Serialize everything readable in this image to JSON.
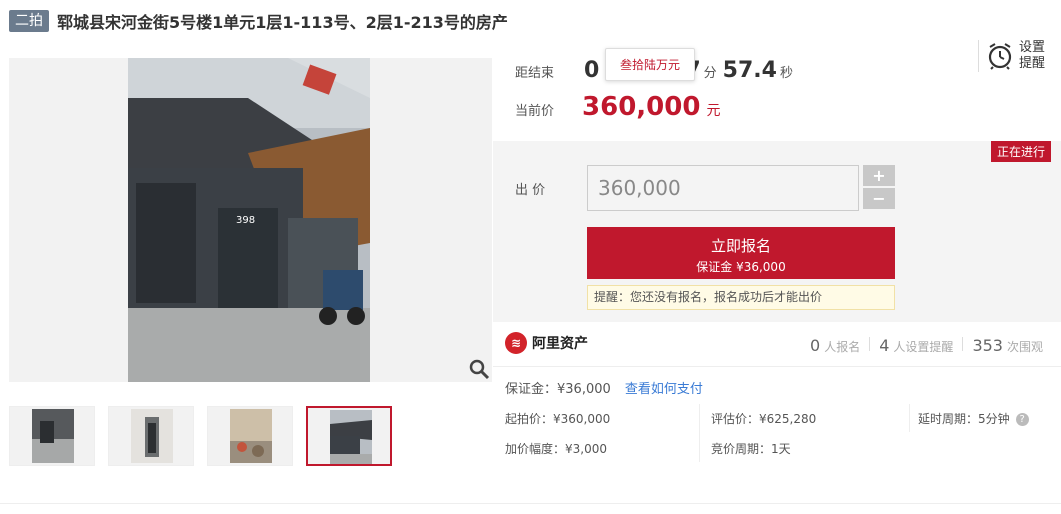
{
  "header": {
    "round_badge": "二拍",
    "title": "郓城县宋河金街5号楼1单元1层1-113号、2层1-213号的房产"
  },
  "gallery": {
    "photo_label": "398",
    "zoom_icon": "magnifier-icon",
    "thumbnails": [
      {
        "name": "thumbnail-1"
      },
      {
        "name": "thumbnail-2"
      },
      {
        "name": "thumbnail-3"
      },
      {
        "name": "thumbnail-4",
        "active": true
      }
    ]
  },
  "countdown": {
    "label": "距结束",
    "hours_partial": "0",
    "minutes_partial": "7",
    "minutes_unit": "分",
    "seconds": "57.4",
    "seconds_unit": "秒",
    "tooltip": "叁拾陆万元"
  },
  "current_price": {
    "label": "当前价",
    "value": "360,000",
    "unit": "元"
  },
  "reminder": {
    "icon": "alarm-clock-icon",
    "label": "设置提醒"
  },
  "bid": {
    "status_tag": "正在进行",
    "label": "出 价",
    "input_value": "360,000",
    "plus": "+",
    "minus": "−",
    "signup_main": "立即报名",
    "signup_sub": "保证金 ¥36,000",
    "notice": "提醒：您还没有报名，报名成功后才能出价"
  },
  "info": {
    "brand": "阿里资产",
    "signups_count": "0",
    "signups_label": "人报名",
    "reminders_count": "4",
    "reminders_label": "人设置提醒",
    "views_count": "353",
    "views_label": "次围观",
    "deposit": "保证金：¥36,000",
    "deposit_link": "查看如何支付",
    "start_price": "起拍价：¥360,000",
    "appraisal": "评估价：¥625,280",
    "delay_period": "延时周期：5分钟",
    "increment": "加价幅度：¥3,000",
    "auction_period": "竞价周期：1天"
  },
  "colors": {
    "accent_red": "#c0182d",
    "badge_gray": "#6b7b8d",
    "link_blue": "#3a7bd5"
  }
}
